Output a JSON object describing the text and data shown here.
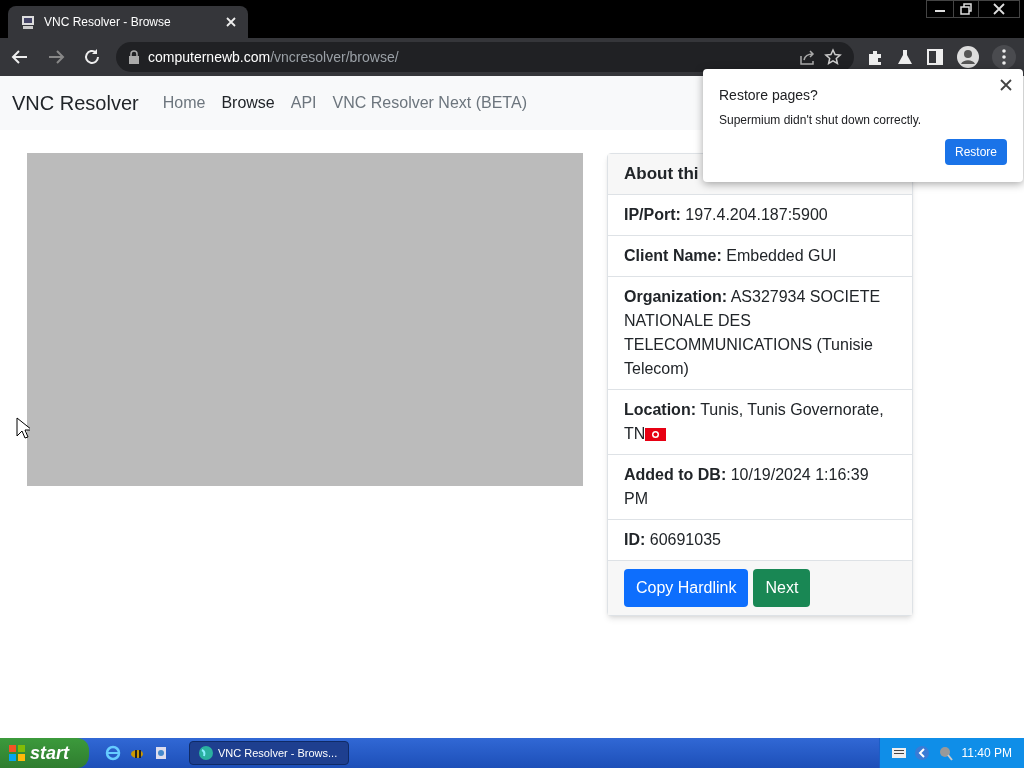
{
  "browser": {
    "tab_title": "VNC Resolver - Browse",
    "url_host": "computernewb.com",
    "url_path": "/vncresolver/browse/"
  },
  "navbar": {
    "brand": "VNC Resolver",
    "links": [
      {
        "label": "Home",
        "selected": false
      },
      {
        "label": "Browse",
        "selected": true
      },
      {
        "label": "API",
        "selected": false
      },
      {
        "label": "VNC Resolver Next (BETA)",
        "selected": false
      }
    ]
  },
  "screenshot": {
    "kind": "placeholder"
  },
  "card": {
    "header": "About thi",
    "rows": [
      {
        "label": "IP/Port:",
        "value": "197.4.204.187:5900"
      },
      {
        "label": "Client Name:",
        "value": "Embedded GUI"
      },
      {
        "label": "Organization:",
        "value": "AS327934 SOCIETE NATIONALE DES TELECOMMUNICATIONS (Tunisie Telecom)"
      },
      {
        "label": "Location:",
        "value": "Tunis, Tunis Governorate, TN",
        "flag": true
      },
      {
        "label": "Added to DB:",
        "value": "10/19/2024 1:16:39 PM"
      },
      {
        "label": "ID:",
        "value": "60691035"
      }
    ],
    "buttons": [
      {
        "label": "Copy Hardlink",
        "kind": "primary"
      },
      {
        "label": "Next",
        "kind": "success"
      }
    ]
  },
  "popup": {
    "title": "Restore pages?",
    "message": "Supermium didn't shut down correctly.",
    "button": "Restore"
  },
  "taskbar": {
    "start": "start",
    "task": "VNC Resolver - Brows...",
    "clock": "11:40 PM"
  }
}
